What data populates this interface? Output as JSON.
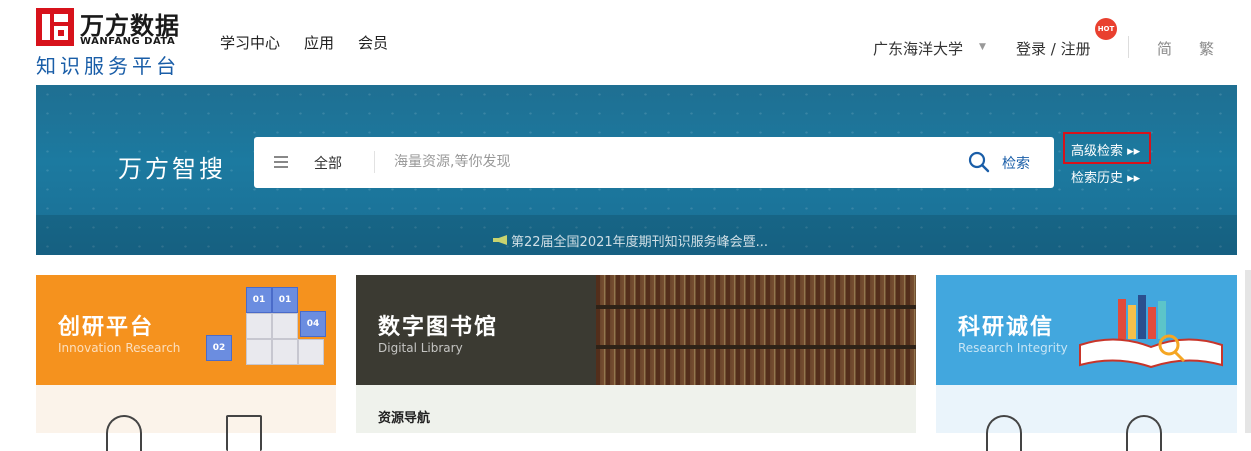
{
  "header": {
    "logo": {
      "title": "万方数据",
      "subtitle": "WANFANG DATA",
      "tagline": "知识服务平台"
    },
    "nav": [
      "学习中心",
      "应用",
      "会员"
    ],
    "institution": "广东海洋大学",
    "login": "登录 / 注册",
    "hot_badge": "HOT",
    "lang_simplified": "简",
    "lang_traditional": "繁"
  },
  "banner": {
    "brand": "万方智搜",
    "scope": "全部",
    "search_placeholder": "海量资源,等你发现",
    "search_button": "检索",
    "advanced_search": "高级检索 ▸▸",
    "search_history": "检索历史 ▸▸",
    "notice": "第22届全国2021年度期刊知识服务峰会暨..."
  },
  "cards": {
    "innovation": {
      "title": "创研平台",
      "subtitle": "Innovation Research"
    },
    "digital_library": {
      "title": "数字图书馆",
      "subtitle": "Digital Library",
      "section_label": "资源导航"
    },
    "integrity": {
      "title": "科研诚信",
      "subtitle": "Research Integrity"
    }
  },
  "colors": {
    "brand_red": "#d7121b",
    "brand_blue": "#1a5ea8",
    "innovation_orange": "#f5921e",
    "library_dark": "#3b3a32",
    "integrity_blue": "#42a7de"
  }
}
